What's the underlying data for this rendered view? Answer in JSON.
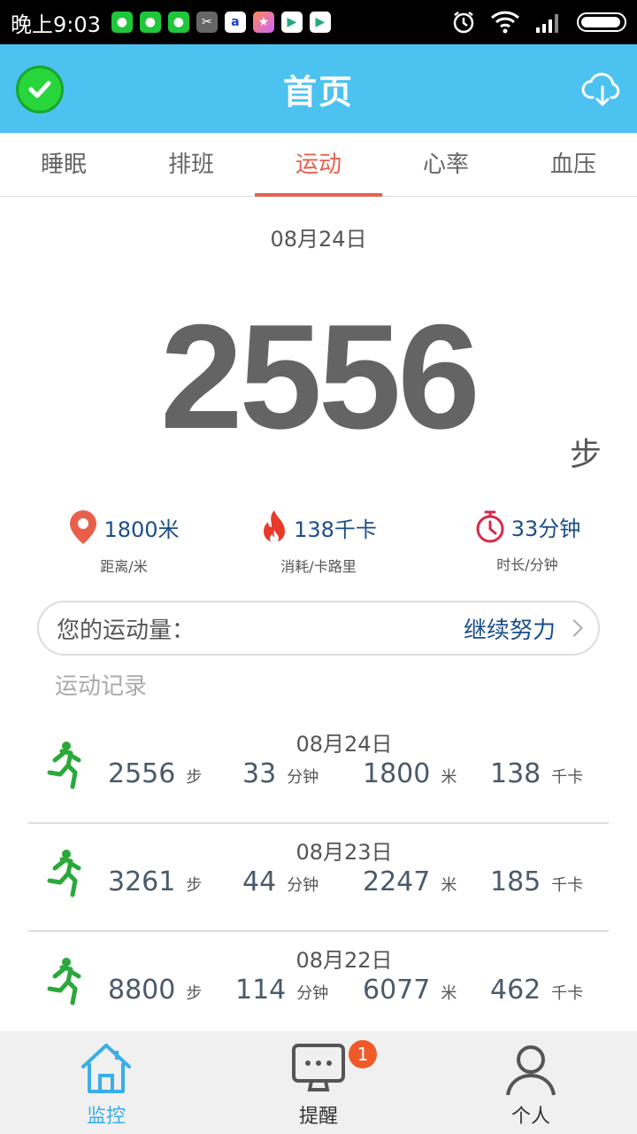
{
  "status_bar": {
    "time": "晚上9:03",
    "notification_icons": [
      "wechat-icon",
      "wechat-icon",
      "wechat-icon",
      "app-icon",
      "app-icon",
      "star-app-icon",
      "play-store-icon",
      "play-store-icon"
    ],
    "right_icons": [
      "alarm-icon",
      "wifi-icon",
      "signal-icon",
      "battery-icon"
    ]
  },
  "header": {
    "title": "首页",
    "left_icon": "check-icon",
    "right_icon": "cloud-download-icon"
  },
  "tabs": [
    {
      "label": "睡眠"
    },
    {
      "label": "排班"
    },
    {
      "label": "运动",
      "active": true
    },
    {
      "label": "心率"
    },
    {
      "label": "血压"
    }
  ],
  "summary": {
    "date": "08月24日",
    "steps": "2556",
    "steps_unit": "步",
    "stats": [
      {
        "icon": "location-pin-icon",
        "value": "1800米",
        "label": "距离/米",
        "color": "#e8604c"
      },
      {
        "icon": "flame-icon",
        "value": "138千卡",
        "label": "消耗/卡路里",
        "color": "#e83a2a"
      },
      {
        "icon": "timer-icon",
        "value": "33分钟",
        "label": "时长/分钟",
        "color": "#d92a4a"
      }
    ]
  },
  "effort": {
    "label": "您的运动量：",
    "value": "继续努力"
  },
  "records_title": "运动记录",
  "records": [
    {
      "date": "08月24日",
      "steps": "2556",
      "steps_unit": "步",
      "minutes": "33",
      "minutes_unit": "分钟",
      "meters": "1800",
      "meters_unit": "米",
      "kcal": "138",
      "kcal_unit": "千卡"
    },
    {
      "date": "08月23日",
      "steps": "3261",
      "steps_unit": "步",
      "minutes": "44",
      "minutes_unit": "分钟",
      "meters": "2247",
      "meters_unit": "米",
      "kcal": "185",
      "kcal_unit": "千卡"
    },
    {
      "date": "08月22日",
      "steps": "8800",
      "steps_unit": "步",
      "minutes": "114",
      "minutes_unit": "分钟",
      "meters": "6077",
      "meters_unit": "米",
      "kcal": "462",
      "kcal_unit": "千卡"
    }
  ],
  "bottom_nav": [
    {
      "label": "监控",
      "icon": "home-icon",
      "active": true
    },
    {
      "label": "提醒",
      "icon": "message-icon",
      "badge": "1"
    },
    {
      "label": "个人",
      "icon": "person-icon"
    }
  ],
  "colors": {
    "header_bg": "#4cc2f0",
    "accent": "#e8604c",
    "nav_active": "#3aaee8",
    "runner": "#2aa83a"
  }
}
